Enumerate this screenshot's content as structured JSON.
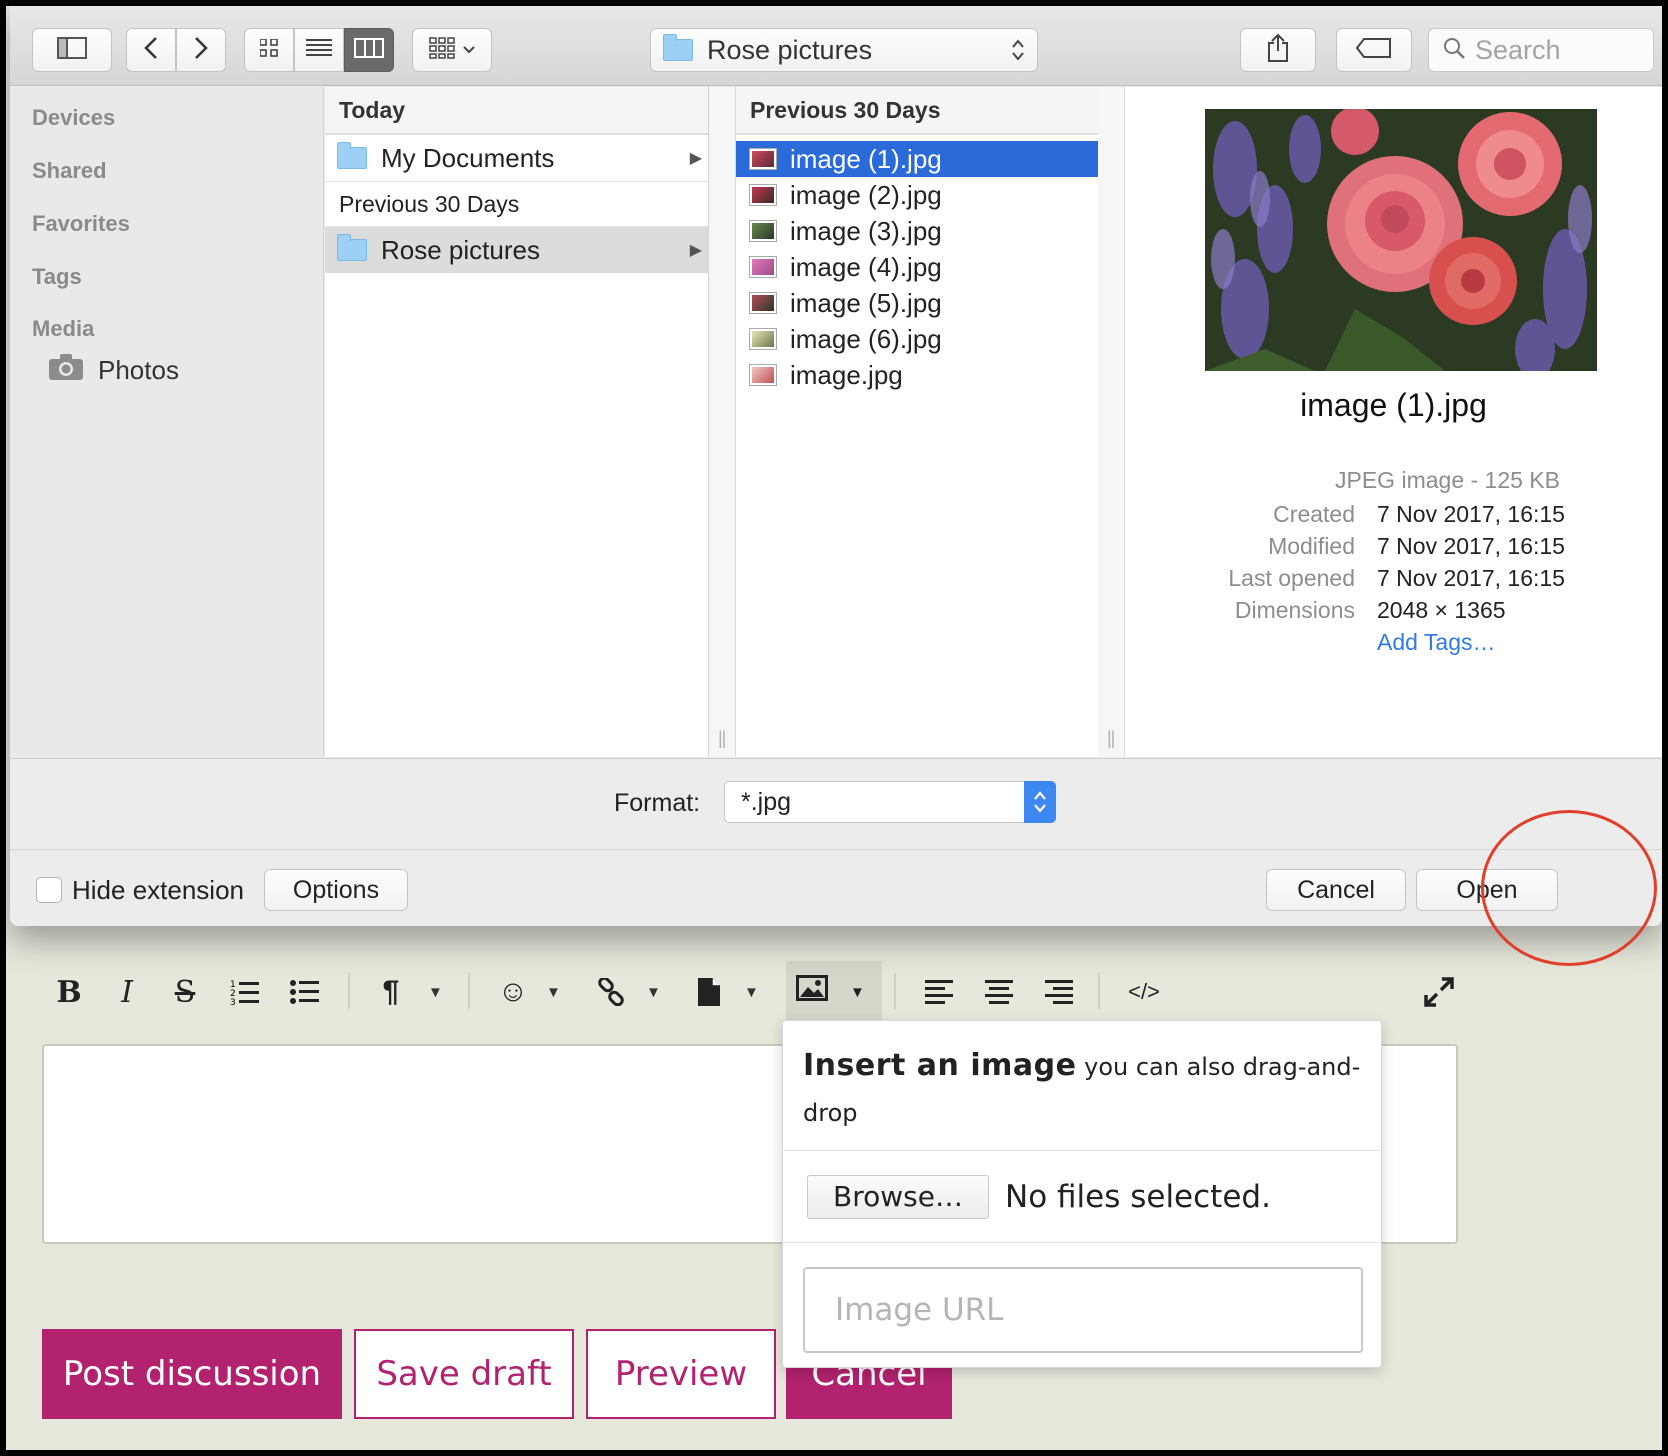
{
  "dialog": {
    "path_folder": "Rose pictures",
    "search_placeholder": "Search",
    "sidebar": {
      "sections": [
        "Devices",
        "Shared",
        "Favorites",
        "Tags",
        "Media"
      ],
      "media_items": [
        {
          "label": "Photos",
          "icon": "camera-icon"
        }
      ]
    },
    "column1": {
      "header": "Today",
      "today_items": [
        {
          "label": "My Documents",
          "icon": "folder-icon"
        }
      ],
      "subheader": "Previous 30 Days",
      "previous_items": [
        {
          "label": "Rose pictures",
          "icon": "folder-icon"
        }
      ]
    },
    "column2": {
      "header": "Previous 30 Days",
      "files": [
        "image (1).jpg",
        "image (2).jpg",
        "image (3).jpg",
        "image (4).jpg",
        "image (5).jpg",
        "image (6).jpg",
        "image.jpg"
      ],
      "selected_index": 0
    },
    "preview": {
      "name": "image (1).jpg",
      "kind": "JPEG image - 125 KB",
      "labels": {
        "created": "Created",
        "modified": "Modified",
        "last_opened": "Last opened",
        "dimensions": "Dimensions"
      },
      "created": "7 Nov 2017, 16:15",
      "modified": "7 Nov 2017, 16:15",
      "last_opened": "7 Nov 2017, 16:15",
      "dimensions": "2048 × 1365",
      "add_tags": "Add Tags…"
    },
    "format_label": "Format:",
    "format_value": "*.jpg",
    "hide_extension_label": "Hide extension",
    "hide_extension_checked": false,
    "options_label": "Options",
    "cancel_label": "Cancel",
    "open_label": "Open",
    "selection_color": "#2b6ad9"
  },
  "editor": {
    "toolbar_icons": [
      "bold-icon",
      "italic-icon",
      "strikethrough-icon",
      "ordered-list-icon",
      "bullet-list-icon",
      "paragraph-icon",
      "emoji-icon",
      "link-icon",
      "file-icon",
      "image-icon",
      "align-left-icon",
      "align-center-icon",
      "align-right-icon",
      "code-view-icon",
      "fullscreen-icon"
    ],
    "insert_image_popup": {
      "title": "Insert an image",
      "subtitle": "you can also drag-and-drop",
      "browse_label": "Browse…",
      "no_files": "No files selected.",
      "url_placeholder": "Image URL"
    },
    "buttons": {
      "post": "Post discussion",
      "save_draft": "Save draft",
      "preview": "Preview",
      "cancel": "Cancel"
    },
    "accent_color": "#b2226f"
  },
  "annotation_color": "#e0402b"
}
